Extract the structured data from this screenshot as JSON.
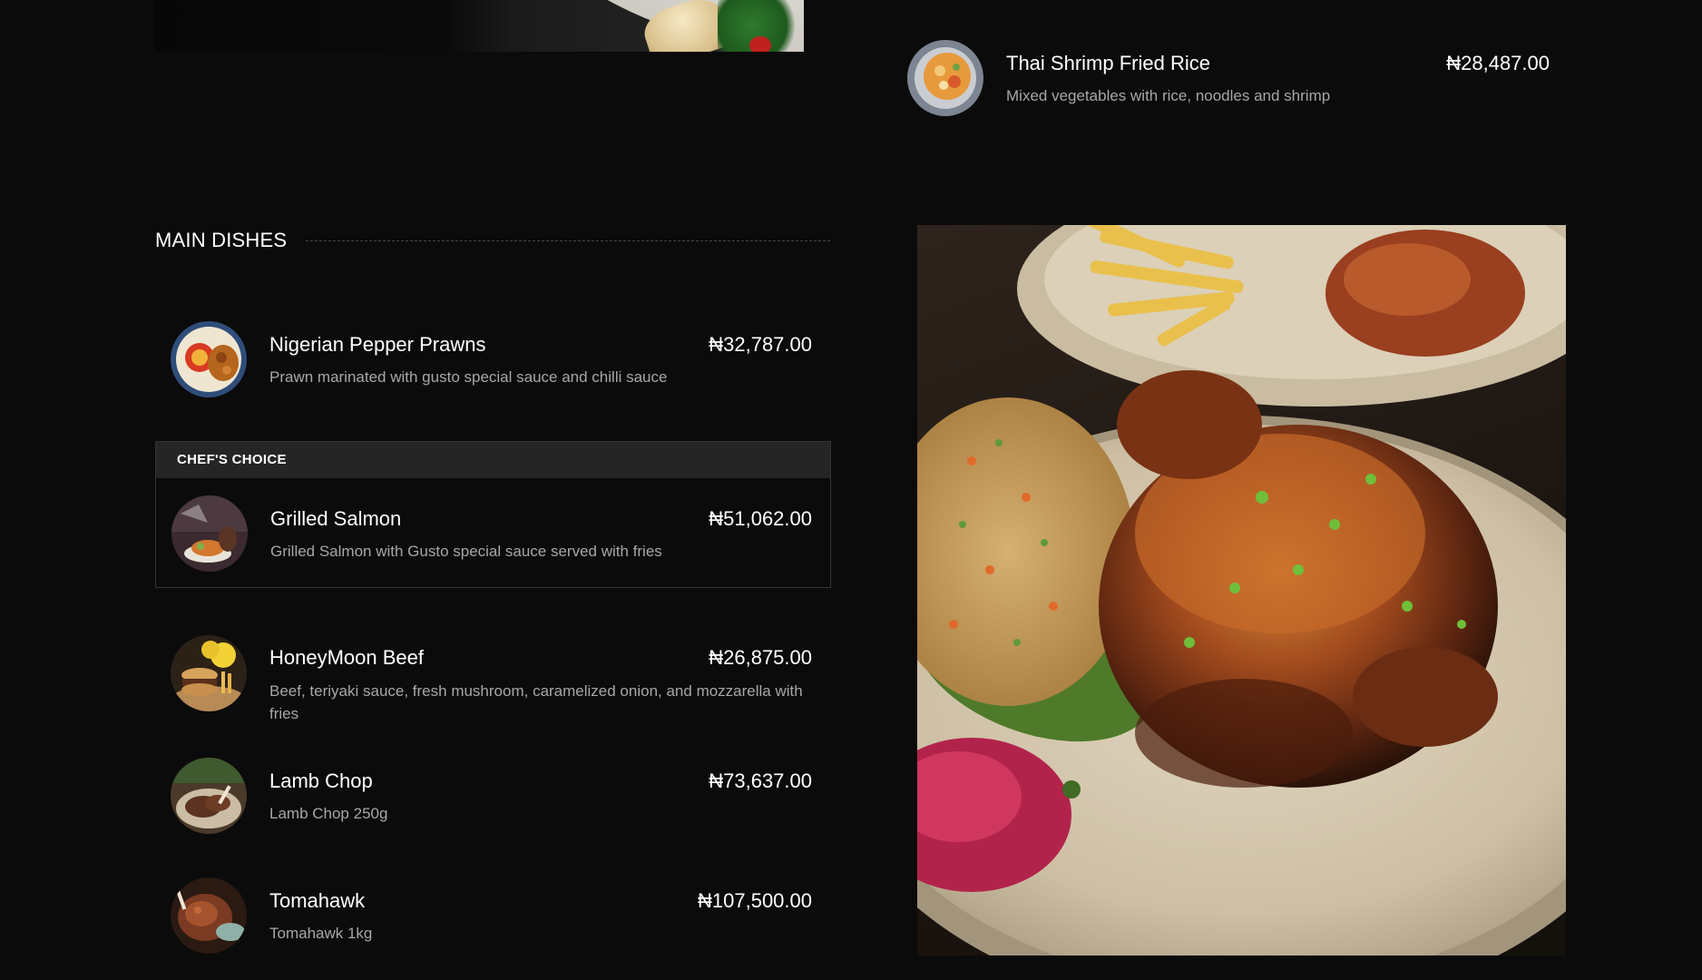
{
  "currency_symbol": "₦",
  "colors": {
    "background": "#0b0b0b",
    "text_primary": "#ffffff",
    "text_secondary": "#a7a7a7",
    "chef_header_bg": "#252525",
    "border": "#333333"
  },
  "featured_top_item": {
    "name": "Thai Shrimp Fried Rice",
    "price": "₦28,487.00",
    "description": "Mixed vegetables with rice, noodles and shrimp"
  },
  "section": {
    "title": "MAIN DISHES",
    "chef_choice_label": "CHEF'S CHOICE",
    "items": [
      {
        "name": "Nigerian Pepper Prawns",
        "price": "₦32,787.00",
        "description": "Prawn marinated with gusto special sauce and chilli sauce"
      },
      {
        "name": "Grilled Salmon",
        "price": "₦51,062.00",
        "description": "Grilled Salmon with Gusto special sauce served with fries",
        "chef_choice": true
      },
      {
        "name": "HoneyMoon Beef",
        "price": "₦26,875.00",
        "description": "Beef, teriyaki sauce, fresh mushroom, caramelized onion, and mozzarella with fries"
      },
      {
        "name": "Lamb Chop",
        "price": "₦73,637.00",
        "description": "Lamb Chop 250g"
      },
      {
        "name": "Tomahawk",
        "price": "₦107,500.00",
        "description": "Tomahawk 1kg"
      }
    ]
  }
}
